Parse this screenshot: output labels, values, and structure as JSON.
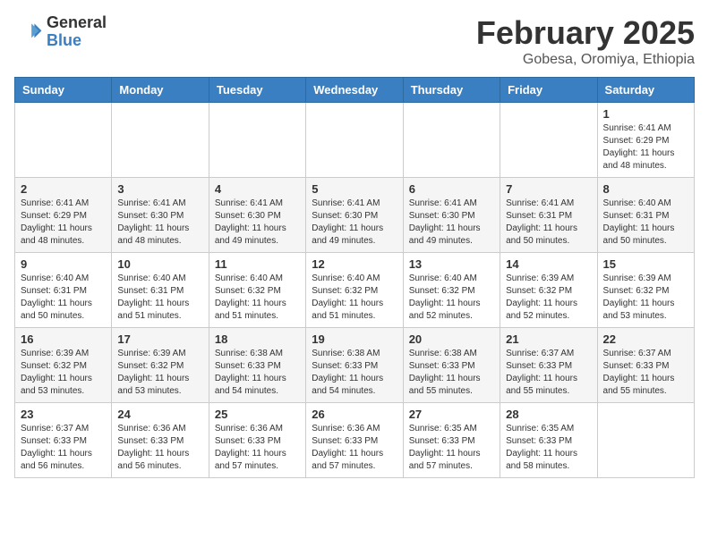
{
  "header": {
    "logo_general": "General",
    "logo_blue": "Blue",
    "month_year": "February 2025",
    "location": "Gobesa, Oromiya, Ethiopia"
  },
  "calendar": {
    "days_of_week": [
      "Sunday",
      "Monday",
      "Tuesday",
      "Wednesday",
      "Thursday",
      "Friday",
      "Saturday"
    ],
    "weeks": [
      [
        {
          "day": "",
          "info": ""
        },
        {
          "day": "",
          "info": ""
        },
        {
          "day": "",
          "info": ""
        },
        {
          "day": "",
          "info": ""
        },
        {
          "day": "",
          "info": ""
        },
        {
          "day": "",
          "info": ""
        },
        {
          "day": "1",
          "info": "Sunrise: 6:41 AM\nSunset: 6:29 PM\nDaylight: 11 hours and 48 minutes."
        }
      ],
      [
        {
          "day": "2",
          "info": "Sunrise: 6:41 AM\nSunset: 6:29 PM\nDaylight: 11 hours and 48 minutes."
        },
        {
          "day": "3",
          "info": "Sunrise: 6:41 AM\nSunset: 6:30 PM\nDaylight: 11 hours and 48 minutes."
        },
        {
          "day": "4",
          "info": "Sunrise: 6:41 AM\nSunset: 6:30 PM\nDaylight: 11 hours and 49 minutes."
        },
        {
          "day": "5",
          "info": "Sunrise: 6:41 AM\nSunset: 6:30 PM\nDaylight: 11 hours and 49 minutes."
        },
        {
          "day": "6",
          "info": "Sunrise: 6:41 AM\nSunset: 6:30 PM\nDaylight: 11 hours and 49 minutes."
        },
        {
          "day": "7",
          "info": "Sunrise: 6:41 AM\nSunset: 6:31 PM\nDaylight: 11 hours and 50 minutes."
        },
        {
          "day": "8",
          "info": "Sunrise: 6:40 AM\nSunset: 6:31 PM\nDaylight: 11 hours and 50 minutes."
        }
      ],
      [
        {
          "day": "9",
          "info": "Sunrise: 6:40 AM\nSunset: 6:31 PM\nDaylight: 11 hours and 50 minutes."
        },
        {
          "day": "10",
          "info": "Sunrise: 6:40 AM\nSunset: 6:31 PM\nDaylight: 11 hours and 51 minutes."
        },
        {
          "day": "11",
          "info": "Sunrise: 6:40 AM\nSunset: 6:32 PM\nDaylight: 11 hours and 51 minutes."
        },
        {
          "day": "12",
          "info": "Sunrise: 6:40 AM\nSunset: 6:32 PM\nDaylight: 11 hours and 51 minutes."
        },
        {
          "day": "13",
          "info": "Sunrise: 6:40 AM\nSunset: 6:32 PM\nDaylight: 11 hours and 52 minutes."
        },
        {
          "day": "14",
          "info": "Sunrise: 6:39 AM\nSunset: 6:32 PM\nDaylight: 11 hours and 52 minutes."
        },
        {
          "day": "15",
          "info": "Sunrise: 6:39 AM\nSunset: 6:32 PM\nDaylight: 11 hours and 53 minutes."
        }
      ],
      [
        {
          "day": "16",
          "info": "Sunrise: 6:39 AM\nSunset: 6:32 PM\nDaylight: 11 hours and 53 minutes."
        },
        {
          "day": "17",
          "info": "Sunrise: 6:39 AM\nSunset: 6:32 PM\nDaylight: 11 hours and 53 minutes."
        },
        {
          "day": "18",
          "info": "Sunrise: 6:38 AM\nSunset: 6:33 PM\nDaylight: 11 hours and 54 minutes."
        },
        {
          "day": "19",
          "info": "Sunrise: 6:38 AM\nSunset: 6:33 PM\nDaylight: 11 hours and 54 minutes."
        },
        {
          "day": "20",
          "info": "Sunrise: 6:38 AM\nSunset: 6:33 PM\nDaylight: 11 hours and 55 minutes."
        },
        {
          "day": "21",
          "info": "Sunrise: 6:37 AM\nSunset: 6:33 PM\nDaylight: 11 hours and 55 minutes."
        },
        {
          "day": "22",
          "info": "Sunrise: 6:37 AM\nSunset: 6:33 PM\nDaylight: 11 hours and 55 minutes."
        }
      ],
      [
        {
          "day": "23",
          "info": "Sunrise: 6:37 AM\nSunset: 6:33 PM\nDaylight: 11 hours and 56 minutes."
        },
        {
          "day": "24",
          "info": "Sunrise: 6:36 AM\nSunset: 6:33 PM\nDaylight: 11 hours and 56 minutes."
        },
        {
          "day": "25",
          "info": "Sunrise: 6:36 AM\nSunset: 6:33 PM\nDaylight: 11 hours and 57 minutes."
        },
        {
          "day": "26",
          "info": "Sunrise: 6:36 AM\nSunset: 6:33 PM\nDaylight: 11 hours and 57 minutes."
        },
        {
          "day": "27",
          "info": "Sunrise: 6:35 AM\nSunset: 6:33 PM\nDaylight: 11 hours and 57 minutes."
        },
        {
          "day": "28",
          "info": "Sunrise: 6:35 AM\nSunset: 6:33 PM\nDaylight: 11 hours and 58 minutes."
        },
        {
          "day": "",
          "info": ""
        }
      ]
    ]
  }
}
